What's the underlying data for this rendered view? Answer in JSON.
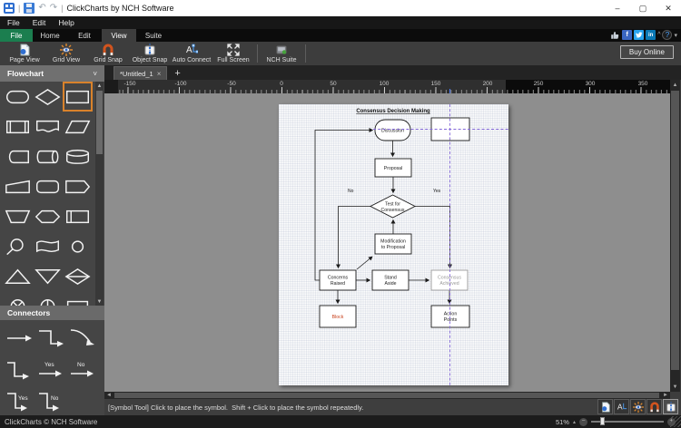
{
  "window": {
    "title": "ClickCharts by NCH Software",
    "controls": {
      "minimize": "–",
      "maximize": "▢",
      "close": "✕"
    }
  },
  "menu": {
    "items": [
      "File",
      "Edit",
      "Help"
    ]
  },
  "ribbon": {
    "tabs": [
      "File",
      "Home",
      "Edit",
      "View",
      "Suite"
    ],
    "active_tab": "View",
    "social_icons": [
      "thumbs-up",
      "facebook",
      "twitter",
      "linkedin"
    ],
    "linkedin_text": "in",
    "facebook_text": "f",
    "help_text": "?",
    "caret_up": "^",
    "caret_down": "▾"
  },
  "toolbar": {
    "buttons": [
      "Page View",
      "Grid View",
      "Grid Snap",
      "Object Snap",
      "Auto Connect",
      "Full Screen",
      "NCH Suite"
    ],
    "buy_online": "Buy Online"
  },
  "sidebar": {
    "header": "Flowchart",
    "chevron": "˅",
    "connectors_header": "Connectors",
    "yes": "Yes",
    "no": "No",
    "shapes": [
      "terminator",
      "decision",
      "process",
      "predefined-process",
      "document",
      "data",
      "stored-data",
      "direct-access-storage",
      "database",
      "manual-input",
      "alternate-process",
      "display",
      "manual-operation",
      "preparation",
      "internal-storage",
      "loop-limit",
      "flag",
      "connector",
      "extract",
      "merge",
      "sort",
      "or-junction",
      "summing-junction",
      "card"
    ],
    "connectors": [
      "straight-arrow",
      "elbow-arrow",
      "curved-arrow",
      "elbow-arrow-2",
      "yes-arrow",
      "no-arrow",
      "elbow-yes-arrow",
      "elbow-no-arrow"
    ]
  },
  "document": {
    "tab_title": "*Untitled_1",
    "close": "×",
    "add_tab": "+"
  },
  "ruler": {
    "labels": [
      "-150",
      "-100",
      "-50",
      "0",
      "50",
      "100",
      "150",
      "200",
      "250",
      "300",
      "350"
    ]
  },
  "flowchart": {
    "title": "Consensus Decision Making",
    "nodes": {
      "discussion": "Discussion",
      "proposal": "Proposal",
      "test1": "Test for",
      "test2": "Consensus",
      "modification1": "Modification",
      "modification2": "to Proposal",
      "concerns1": "Concerns",
      "concerns2": "Raised",
      "stand1": "Stand",
      "stand2": "Aside",
      "achieved1": "Consensus",
      "achieved2": "Achieved",
      "block": "Block",
      "action1": "Action",
      "action2": "Points"
    },
    "edge_labels": {
      "yes": "Yes",
      "no": "No"
    }
  },
  "statusbar": {
    "message": "[Symbol Tool] Click to place the symbol.  Shift + Click to place the symbol repeatedly."
  },
  "bottombar": {
    "copyright": "ClickCharts © NCH Software",
    "zoom_level": "51%",
    "zoom_out": "−",
    "zoom_in": "+"
  },
  "scroll": {
    "up": "▲",
    "down": "▼",
    "left": "◄",
    "right": "►"
  },
  "colors": {
    "file_tab_green": "#1b7e4f",
    "selection_orange": "#d9822b",
    "crosshair_purple": "#8468d9",
    "block_text_red": "#c8401a",
    "facebook_blue": "#3a66c2",
    "twitter_blue": "#2aa3ef",
    "linkedin_blue": "#0a78b5"
  }
}
